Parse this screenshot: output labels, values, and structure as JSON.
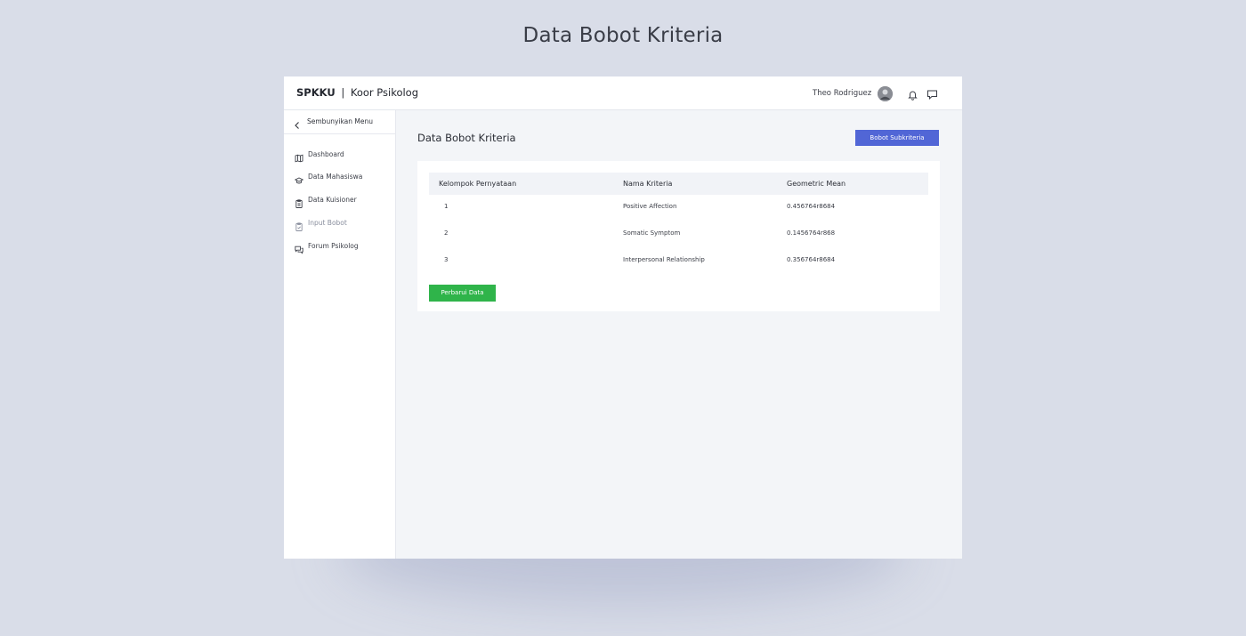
{
  "page_heading": "Data Bobot Kriteria",
  "header": {
    "brand_strong": "SPKKU",
    "brand_separator": "|",
    "brand_role": "Koor Psikolog",
    "user_name": "Theo Rodriguez",
    "icons": [
      "avatar",
      "bell-icon",
      "chat-icon"
    ]
  },
  "sidebar": {
    "hide_menu_label": "Sembunyikan Menu",
    "items": [
      {
        "label": "Dashboard",
        "icon": "map-icon",
        "active": false
      },
      {
        "label": "Data Mahasiswa",
        "icon": "graduation-cap-icon",
        "active": false
      },
      {
        "label": "Data Kuisioner",
        "icon": "clipboard-icon",
        "active": false
      },
      {
        "label": "Input Bobot",
        "icon": "clipboard-check-icon",
        "active": true
      },
      {
        "label": "Forum Psikolog",
        "icon": "chat-bubbles-icon",
        "active": false
      }
    ]
  },
  "main": {
    "title": "Data Bobot Kriteria",
    "subkriteria_button": "Bobot Subkriteria",
    "table": {
      "headers": [
        "Kelompok Pernyataan",
        "Nama Kriteria",
        "Geometric Mean"
      ],
      "rows": [
        [
          "1",
          "Positive Affection",
          "0.456764r8684"
        ],
        [
          "2",
          "Somatic Symptom",
          "0.1456764r868"
        ],
        [
          "3",
          "Interpersonal Relationship",
          "0.356764r8684"
        ]
      ]
    },
    "update_button": "Perbarui Data"
  },
  "colors": {
    "background": "#d9dde8",
    "primary_button": "#5166d6",
    "success_button": "#2fb44a"
  }
}
